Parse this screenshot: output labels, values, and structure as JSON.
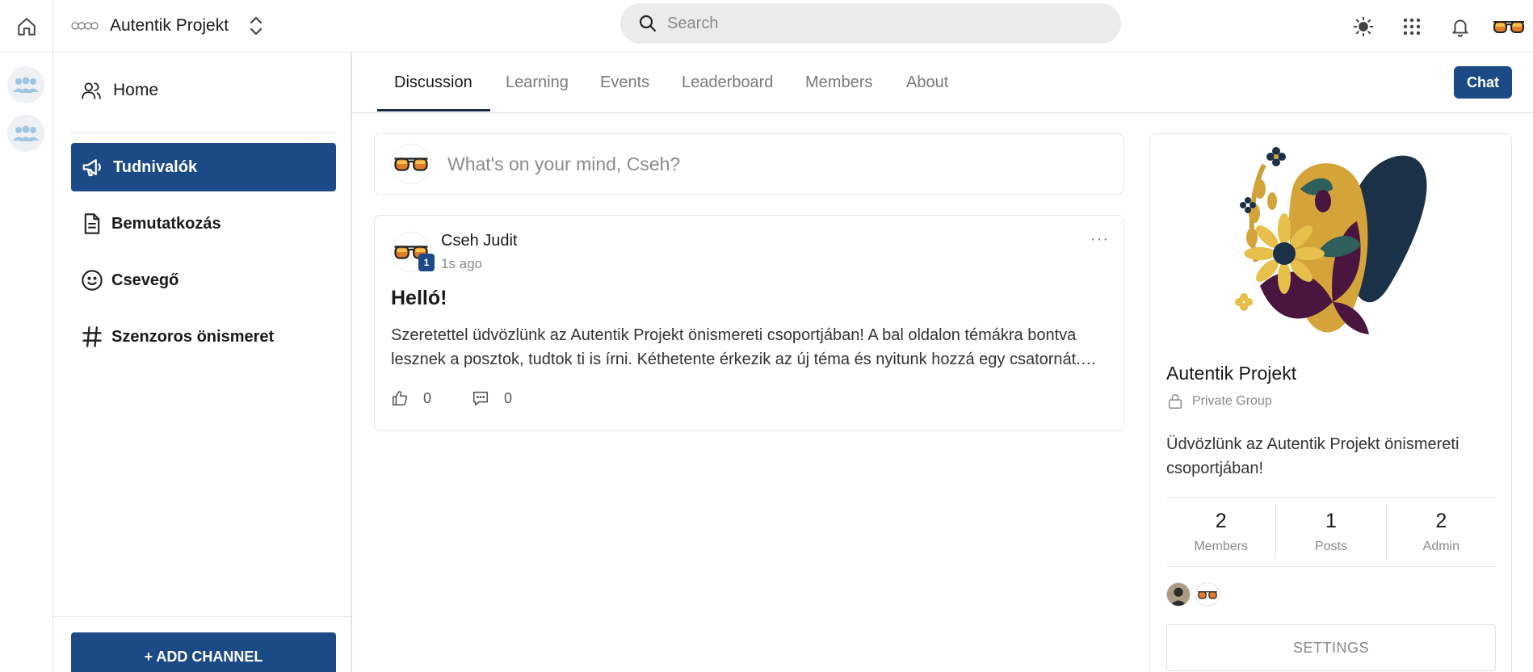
{
  "header": {
    "project_name": "Autentik Projekt",
    "search_placeholder": "Search"
  },
  "sidebar": {
    "home_label": "Home",
    "channels": [
      {
        "label": "Tudnivalók",
        "icon": "megaphone-icon",
        "active": true
      },
      {
        "label": "Bemutatkozás",
        "icon": "document-icon",
        "active": false
      },
      {
        "label": "Csevegő",
        "icon": "smiley-icon",
        "active": false
      },
      {
        "label": "Szenzoros önismeret",
        "icon": "hash-icon",
        "active": false
      }
    ],
    "add_channel_label": "+ ADD CHANNEL"
  },
  "tabs": [
    {
      "label": "Discussion",
      "active": true
    },
    {
      "label": "Learning",
      "active": false
    },
    {
      "label": "Events",
      "active": false
    },
    {
      "label": "Leaderboard",
      "active": false
    },
    {
      "label": "Members",
      "active": false
    },
    {
      "label": "About",
      "active": false
    }
  ],
  "chat_label": "Chat",
  "composer": {
    "placeholder": "What's on your mind, Cseh?"
  },
  "post": {
    "author": "Cseh Judit",
    "badge": "1",
    "time": "1s ago",
    "title": "Helló!",
    "body": "Szeretettel üdvözlünk az Autentik Projekt önismereti csoportjában! A bal oldalon témákra bontva lesznek a posztok, tudtok ti is írni. Kéthetente érkezik az új téma és nyitunk hozzá egy csatornát.…",
    "likes": "0",
    "comments": "0",
    "menu": "···"
  },
  "group": {
    "name": "Autentik Projekt",
    "privacy": "Private Group",
    "description": "Üdvözlünk az Autentik Projekt önismereti csoportjában!",
    "stats": [
      {
        "value": "2",
        "label": "Members"
      },
      {
        "value": "1",
        "label": "Posts"
      },
      {
        "value": "2",
        "label": "Admin"
      }
    ],
    "settings_label": "SETTINGS"
  },
  "colors": {
    "primary": "#1c4a86",
    "art_gold": "#d4a43a",
    "art_navy": "#1b3147",
    "art_plum": "#4a1640"
  }
}
